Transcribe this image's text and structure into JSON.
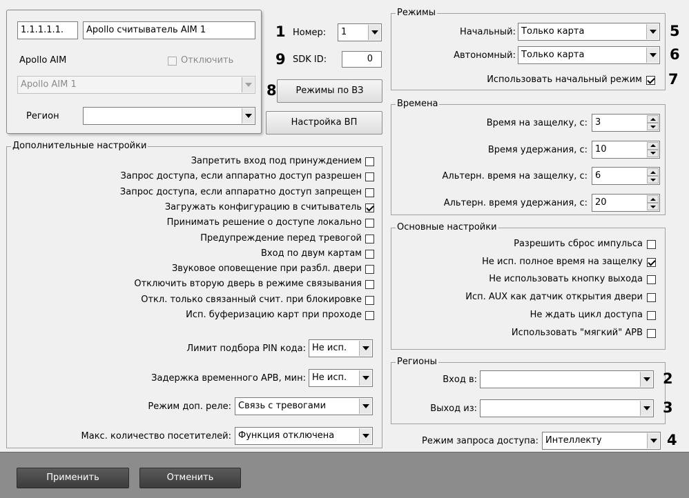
{
  "top_group": {
    "address": "1.1.1.1.1.",
    "name": "Apollo считыватель AIM 1",
    "aim_label": "Apollo AIM",
    "disable_label": "Отключить",
    "aim_select": "Apollo AIM 1",
    "region_label": "Регион",
    "region_value": ""
  },
  "center": {
    "number_label": "Номер:",
    "number_value": "1",
    "sdk_label": "SDK ID:",
    "sdk_value": "0",
    "modes_bz_label": "Режимы по ВЗ",
    "setup_vp_label": "Настройка ВП"
  },
  "annotations": [
    "1",
    "9",
    "8",
    "5",
    "6",
    "7",
    "2",
    "3",
    "4"
  ],
  "extra": {
    "title": "Дополнительные настройки",
    "checks": [
      {
        "label": "Запретить вход под принуждением",
        "checked": false
      },
      {
        "label": "Запрос доступа, если аппаратно доступ разрешен",
        "checked": false
      },
      {
        "label": "Запрос доступа, если аппаратно доступ запрещен",
        "checked": false
      },
      {
        "label": "Загружать конфигурацию в считыватель",
        "checked": true
      },
      {
        "label": "Принимать решение о доступе локально",
        "checked": false
      },
      {
        "label": "Предупреждение перед тревогой",
        "checked": false
      },
      {
        "label": "Вход по двум картам",
        "checked": false
      },
      {
        "label": "Звуковое оповещение при разбл. двери",
        "checked": false
      },
      {
        "label": "Отключить вторую дверь в режиме связывания",
        "checked": false
      },
      {
        "label": "Откл. только связанный счит. при блокировке",
        "checked": false
      },
      {
        "label": "Исп. буферизацию карт при проходе",
        "checked": false
      }
    ],
    "pin_limit_label": "Лимит подбора PIN кода:",
    "pin_limit_value": "Не исп.",
    "apb_delay_label": "Задержка временного APB, мин:",
    "apb_delay_value": "Не исп.",
    "relay_mode_label": "Режим доп. реле:",
    "relay_mode_value": "Связь с тревогами",
    "max_visitors_label": "Макс. количество посетителей:",
    "max_visitors_value": "Функция отключена"
  },
  "modes": {
    "title": "Режимы",
    "initial_label": "Начальный:",
    "initial_value": "Только карта",
    "autonomous_label": "Автономный:",
    "autonomous_value": "Только карта",
    "use_initial_label": "Использовать начальный режим",
    "use_initial_checked": true
  },
  "times": {
    "title": "Времена",
    "rows": [
      {
        "label": "Время на защелку, с:",
        "value": "3"
      },
      {
        "label": "Время удержания, с:",
        "value": "10"
      },
      {
        "label": "Альтерн. время на защелку, с:",
        "value": "6"
      },
      {
        "label": "Альтерн. время удержания, с:",
        "value": "20"
      }
    ]
  },
  "basic": {
    "title": "Основные настройки",
    "checks": [
      {
        "label": "Разрешить сброс импульса",
        "checked": false
      },
      {
        "label": "Не исп. полное время на защелку",
        "checked": true
      },
      {
        "label": "Не использовать кнопку выхода",
        "checked": false
      },
      {
        "label": "Исп. AUX как датчик открытия двери",
        "checked": false
      },
      {
        "label": "Не ждать цикл доступа",
        "checked": false
      },
      {
        "label": "Использовать \"мягкий\" APB",
        "checked": false
      }
    ]
  },
  "regions": {
    "title": "Регионы",
    "entry_label": "Вход в:",
    "entry_value": "",
    "exit_label": "Выход из:",
    "exit_value": ""
  },
  "access_mode": {
    "label": "Режим запроса доступа:",
    "value": "Интеллекту"
  },
  "footer": {
    "apply_label": "Применить",
    "cancel_label": "Отменить"
  }
}
